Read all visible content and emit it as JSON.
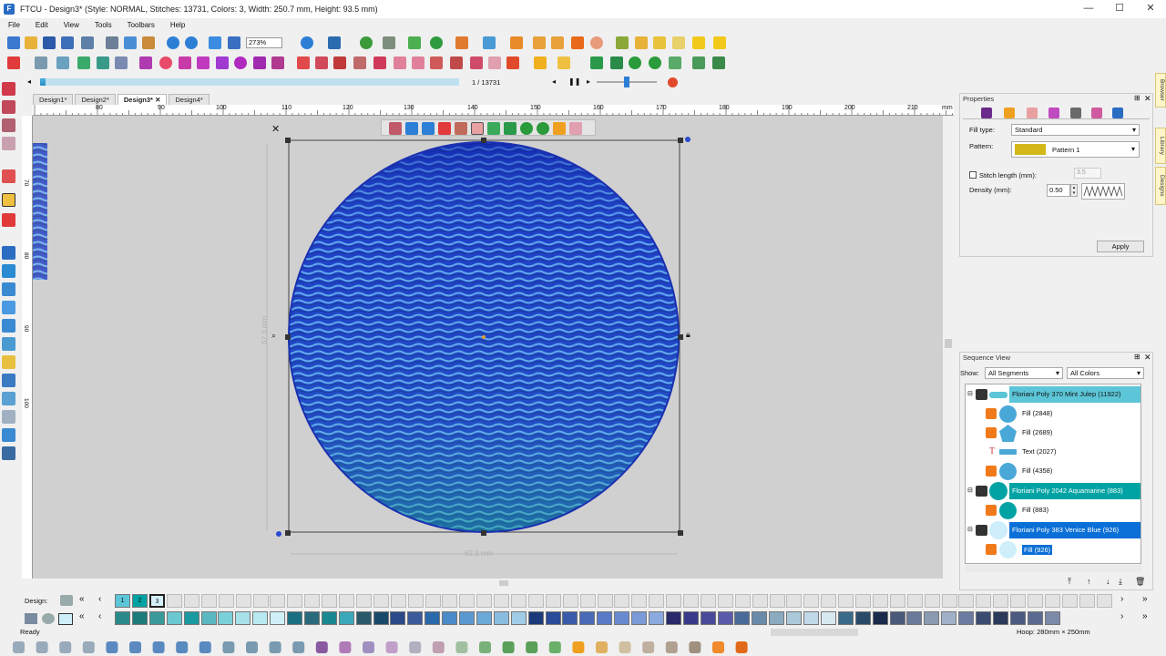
{
  "window": {
    "title": "FTCU - Design3* (Style: NORMAL, Stitches: 13731, Colors: 3, Width: 250.7 mm, Height: 93.5 mm)",
    "minimize": "—",
    "maximize": "☐",
    "close": "✕"
  },
  "menu": [
    "File",
    "Edit",
    "View",
    "Tools",
    "Toolbars",
    "Help"
  ],
  "toolbar": {
    "zoom_value": "273%",
    "stitch_counter": "1 / 13731"
  },
  "playback": {
    "progress_fraction": 0.001,
    "speed_fraction": 0.45
  },
  "tabs": [
    {
      "label": "Design1*",
      "active": false
    },
    {
      "label": "Design2*",
      "active": false
    },
    {
      "label": "Design3*",
      "active": true,
      "close": "✕"
    },
    {
      "label": "Design4*",
      "active": false
    }
  ],
  "ruler": {
    "h_labels": [
      "80",
      "90",
      "100",
      "110",
      "120",
      "130",
      "140",
      "150",
      "160",
      "170",
      "180",
      "190",
      "200",
      "210"
    ],
    "h_unit": "mm",
    "v_labels": [
      "70",
      "80",
      "90",
      "100"
    ]
  },
  "canvas": {
    "dimension_width_label": "62.3 mm",
    "dimension_height_label": "62.3 mm",
    "selection_close": "✕"
  },
  "properties": {
    "title": "Properties",
    "fill_type_label": "Fill type:",
    "fill_type_value": "Standard",
    "pattern_label": "Pattern:",
    "pattern_value": "Pattern  1",
    "stitch_length_label": "Stitch length (mm):",
    "stitch_length_value": "3.5",
    "density_label": "Density (mm):",
    "density_value": "0.50",
    "apply_label": "Apply"
  },
  "side_tabs": [
    "Browser",
    "Library",
    "Designs"
  ],
  "sequence": {
    "title": "Sequence View",
    "show_label": "Show:",
    "segments_filter": "All Segments",
    "colors_filter": "All Colors",
    "rows": [
      {
        "type": "color",
        "label": "Floriani Poly 370 Mint Julep (11922)",
        "bg": "#5cc6d8",
        "fg": "#111"
      },
      {
        "type": "item",
        "label": "Fill (2848)"
      },
      {
        "type": "item",
        "label": "Fill (2689)"
      },
      {
        "type": "item",
        "label": "Text (2027)"
      },
      {
        "type": "item",
        "label": "Fill (4358)"
      },
      {
        "type": "color",
        "label": "Floriani Poly 2042 Aquamarine (883)",
        "bg": "#00a3a3",
        "fg": "#fff"
      },
      {
        "type": "item",
        "label": "Fill (883)"
      },
      {
        "type": "color",
        "label": "Floriani Poly 383 Venice Blue (926)",
        "bg": "#0a6fd6",
        "fg": "#fff"
      },
      {
        "type": "item",
        "label": "Fill (926)",
        "selected": true
      }
    ]
  },
  "palette": {
    "design_label": "Design:",
    "design_colors": [
      {
        "color": "#5cc6d8",
        "label": "1"
      },
      {
        "color": "#00a3a3",
        "label": "2"
      },
      {
        "color": "#d6f1fb",
        "label": "3"
      }
    ]
  },
  "status": {
    "left": "Ready",
    "hoop": "Hoop: 280mm × 250mm"
  },
  "colors": {
    "accent": "#0a6fd6",
    "mint": "#5cc6d8",
    "aquamarine": "#00a3a3",
    "canvas_bg": "#d0d0d0"
  }
}
